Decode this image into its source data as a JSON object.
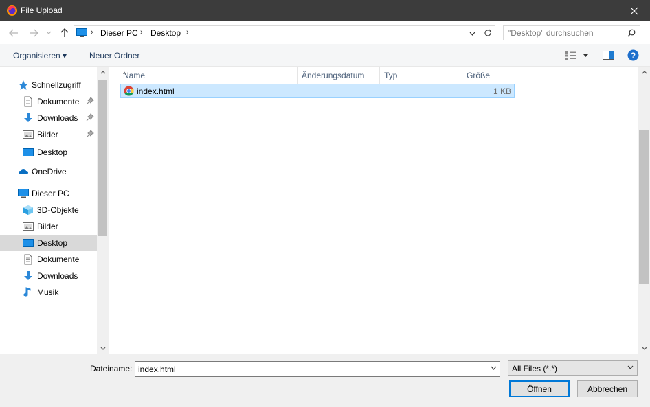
{
  "window": {
    "title": "File Upload",
    "app_icon": "firefox-icon",
    "close_icon": "close-icon"
  },
  "navigation": {
    "back_icon": "arrow-left-icon",
    "forward_icon": "arrow-right-icon",
    "recent_icon": "chevron-down-icon",
    "up_icon": "arrow-up-icon",
    "breadcrumb": [
      "Dieser PC",
      "Desktop"
    ],
    "refresh_icon": "refresh-icon",
    "search_placeholder": "\"Desktop\" durchsuchen"
  },
  "toolbar": {
    "organize": "Organisieren",
    "new_folder": "Neuer Ordner",
    "view_icon": "view-options-icon",
    "preview_icon": "preview-pane-icon",
    "help_icon": "help-icon"
  },
  "sidebar": {
    "items": [
      {
        "label": "Schnellzugriff",
        "icon": "star-icon",
        "pinned": false
      },
      {
        "label": "Dokumente",
        "icon": "document-icon",
        "pinned": true
      },
      {
        "label": "Downloads",
        "icon": "download-icon",
        "pinned": true
      },
      {
        "label": "Bilder",
        "icon": "pictures-icon",
        "pinned": true
      },
      {
        "label": "Desktop",
        "icon": "desktop-icon",
        "pinned": false
      },
      {
        "label": "OneDrive",
        "icon": "cloud-icon",
        "pinned": false
      },
      {
        "label": "Dieser PC",
        "icon": "computer-icon",
        "pinned": false
      },
      {
        "label": "3D-Objekte",
        "icon": "cube-icon",
        "pinned": false
      },
      {
        "label": "Bilder",
        "icon": "pictures-icon",
        "pinned": false
      },
      {
        "label": "Desktop",
        "icon": "desktop-icon",
        "pinned": false,
        "selected": true
      },
      {
        "label": "Dokumente",
        "icon": "document-icon",
        "pinned": false
      },
      {
        "label": "Downloads",
        "icon": "download-icon",
        "pinned": false
      },
      {
        "label": "Musik",
        "icon": "music-icon",
        "pinned": false
      }
    ]
  },
  "file_list": {
    "columns": [
      "Name",
      "Änderungsdatum",
      "Typ",
      "Größe"
    ],
    "rows": [
      {
        "name": "index.html",
        "modified": "",
        "type": "",
        "size": "1 KB",
        "icon": "chrome-icon",
        "selected": true
      }
    ]
  },
  "footer": {
    "filename_label": "Dateiname:",
    "filename_value": "index.html",
    "filter_value": "All Files (*.*)",
    "open_button": "Öffnen",
    "cancel_button": "Abbrechen"
  },
  "colors": {
    "titlebar": "#3c3c3c",
    "selection": "#cce8ff",
    "selection_border": "#99d1ff",
    "accent": "#0078d7"
  }
}
